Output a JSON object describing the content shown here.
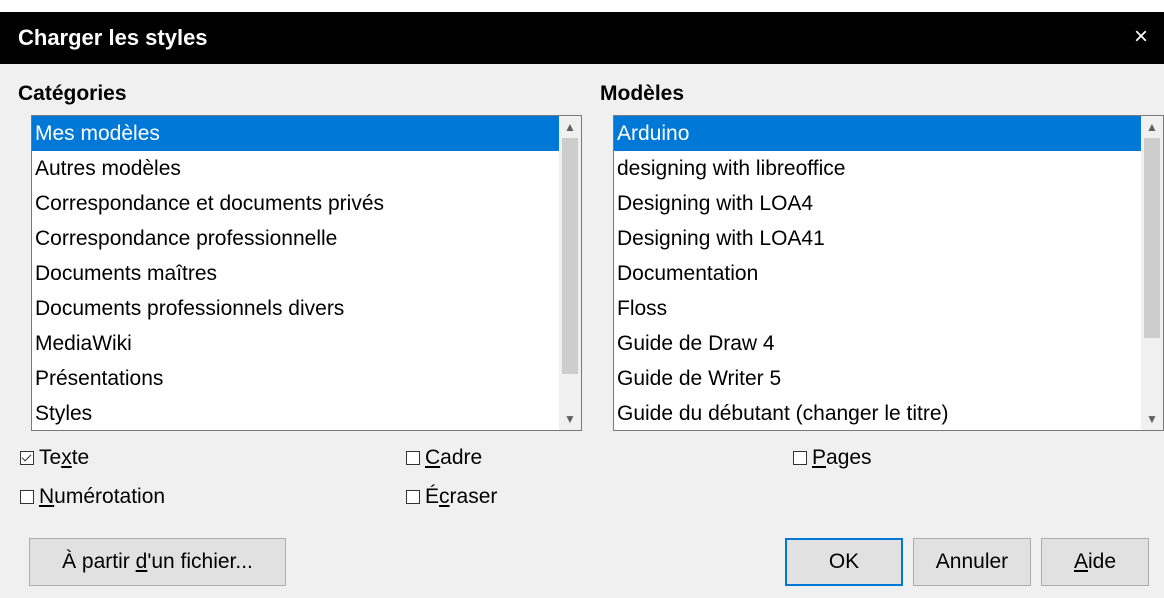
{
  "window": {
    "title": "Charger les styles",
    "close_glyph": "×"
  },
  "categories": {
    "heading": "Catégories",
    "items": [
      "Mes modèles",
      "Autres modèles",
      "Correspondance et documents privés",
      "Correspondance professionnelle",
      "Documents maîtres",
      "Documents professionnels divers",
      "MediaWiki",
      "Présentations",
      "Styles"
    ],
    "selected": "Mes modèles"
  },
  "templates": {
    "heading": "Modèles",
    "items": [
      "Arduino",
      "designing with libreoffice",
      "Designing with LOA4",
      "Designing with LOA41",
      "Documentation",
      "Floss",
      "Guide de Draw 4",
      "Guide de Writer 5",
      "Guide du débutant (changer le titre)"
    ],
    "selected": "Arduino"
  },
  "options": {
    "text": {
      "pre": "Te",
      "u": "x",
      "post": "te",
      "checked": true
    },
    "frame": {
      "pre": "",
      "u": "C",
      "post": "adre",
      "checked": false
    },
    "pages": {
      "pre": "",
      "u": "P",
      "post": "ages",
      "checked": false
    },
    "numbering": {
      "pre": "",
      "u": "N",
      "post": "umérotation",
      "checked": false
    },
    "overwrite": {
      "pre": "É",
      "u": "c",
      "post": "raser",
      "checked": false
    }
  },
  "buttons": {
    "from_file": {
      "pre": "À partir ",
      "u": "d",
      "post": "'un fichier..."
    },
    "ok": "OK",
    "cancel": "Annuler",
    "help": {
      "pre": "",
      "u": "A",
      "post": "ide"
    }
  },
  "colors": {
    "selection": "#0078d7",
    "titlebar": "#000000",
    "dialog_bg": "#f0f0f0"
  }
}
